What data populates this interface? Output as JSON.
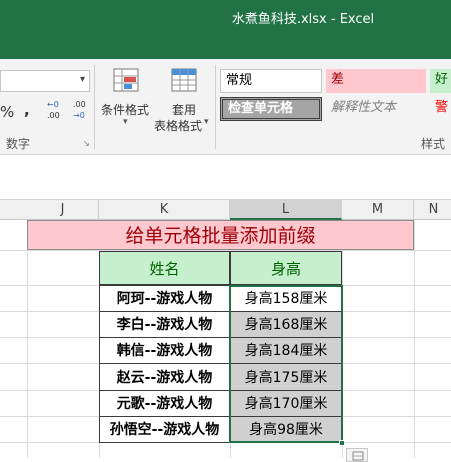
{
  "window": {
    "title": "水煮鱼科技.xlsx - Excel"
  },
  "ribbon": {
    "percent_symbol": "%",
    "comma_symbol": ",",
    "inc_decimal_label": "←0 .00",
    "dec_decimal_label": ".00 →0",
    "number_group_label": "数字",
    "conditional_format_label": "条件格式",
    "table_format_line1": "套用",
    "table_format_line2": "表格格式",
    "styles": {
      "normal": "常规",
      "bad": "差",
      "good": "好",
      "check_cell": "检查单元格",
      "explanatory": "解释性文本",
      "warning": "警"
    },
    "styles_group_label": "样式"
  },
  "columns": [
    "J",
    "K",
    "L",
    "M",
    "N"
  ],
  "sheet": {
    "title": "给单元格批量添加前缀",
    "headers": {
      "name": "姓名",
      "height": "身高"
    },
    "rows": [
      {
        "name": "阿珂--游戏人物",
        "height": "身高158厘米"
      },
      {
        "name": "李白--游戏人物",
        "height": "身高168厘米"
      },
      {
        "name": "韩信--游戏人物",
        "height": "身高184厘米"
      },
      {
        "name": "赵云--游戏人物",
        "height": "身高175厘米"
      },
      {
        "name": "元歌--游戏人物",
        "height": "身高170厘米"
      },
      {
        "name": "孙悟空--游戏人物",
        "height": "身高98厘米"
      }
    ]
  },
  "colors": {
    "title_bar": "#217346",
    "title_band": "#ffc7ce",
    "header_fill": "#c6efce",
    "selected_fill": "#d0d0d0",
    "selection_border": "#217346"
  }
}
